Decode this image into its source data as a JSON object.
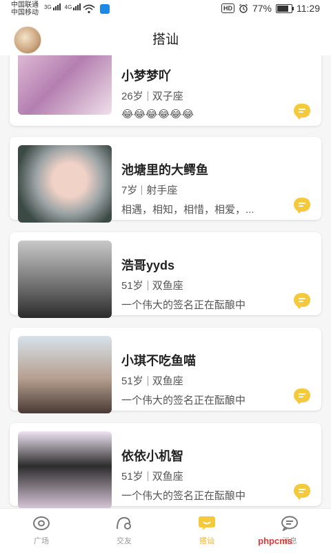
{
  "status_bar": {
    "carrier_1": "中国联通",
    "carrier_2": "中国移动",
    "net_1": "3G",
    "net_2": "4G",
    "battery": "77%",
    "time": "11:29"
  },
  "header": {
    "title": "搭讪"
  },
  "feed": [
    {
      "name": "小梦梦吖",
      "age": "26岁",
      "zodiac": "双子座",
      "signature": "😂😂😂😂😂😂"
    },
    {
      "name": "池塘里的大鳄鱼",
      "age": "7岁",
      "zodiac": "射手座",
      "signature": "相遇，相知，相惜，相爱，..."
    },
    {
      "name": "浩哥yyds",
      "age": "51岁",
      "zodiac": "双鱼座",
      "signature": "一个伟大的签名正在酝酿中"
    },
    {
      "name": "小琪不吃鱼喵",
      "age": "51岁",
      "zodiac": "双鱼座",
      "signature": "一个伟大的签名正在酝酿中"
    },
    {
      "name": "依依小机智",
      "age": "51岁",
      "zodiac": "双鱼座",
      "signature": "一个伟大的签名正在酝酿中"
    }
  ],
  "bottom_nav": {
    "items": [
      {
        "label": "广场",
        "icon": "square-icon"
      },
      {
        "label": "交友",
        "icon": "friends-icon"
      },
      {
        "label": "搭讪",
        "icon": "chat-bubble-icon"
      },
      {
        "label": "消息",
        "icon": "message-icon"
      }
    ],
    "active_index": 2,
    "accent_color": "#f5c93c",
    "inactive_color": "#999999"
  },
  "watermark": "phpcms"
}
